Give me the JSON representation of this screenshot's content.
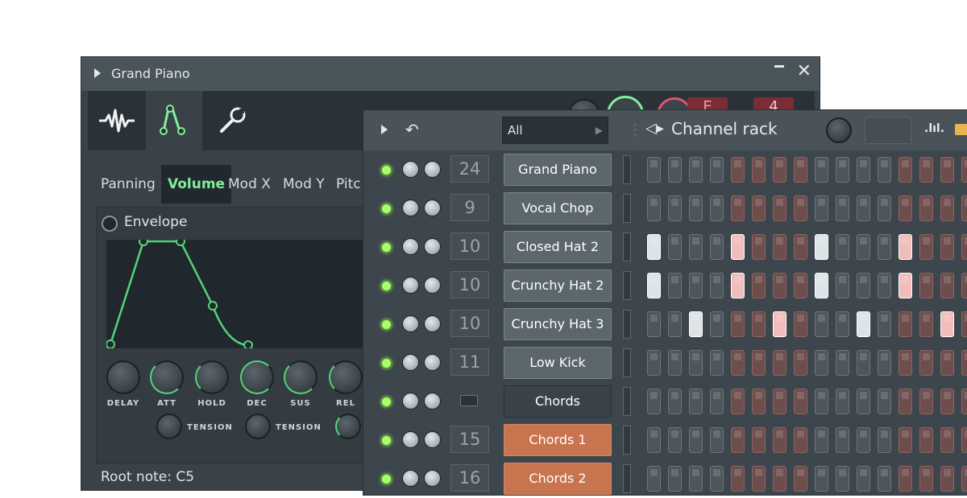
{
  "plugin": {
    "title": "Grand Piano",
    "tabs": [
      {
        "name": "waveform-icon"
      },
      {
        "name": "envelope-icon"
      },
      {
        "name": "wrench-icon"
      }
    ],
    "subtabs": [
      "Panning",
      "Volume",
      "Mod X",
      "Mod Y",
      "Pitc"
    ],
    "active_subtab": "Volume",
    "envelope": {
      "label": "Envelope",
      "knob_labels": [
        "DELAY",
        "ATT",
        "HOLD",
        "DEC",
        "SUS",
        "REL"
      ],
      "tension_labels": [
        "TENSION",
        "TENSION"
      ]
    },
    "root_note": "Root note: C5",
    "header_display_1": "E",
    "header_display_2": "4"
  },
  "rack": {
    "title": "Channel rack",
    "filter": "All",
    "rows": [
      {
        "num": "24",
        "name": "Grand Piano",
        "style": "normal"
      },
      {
        "num": "9",
        "name": "Vocal Chop",
        "style": "normal"
      },
      {
        "num": "10",
        "name": "Closed Hat 2",
        "style": "normal"
      },
      {
        "num": "10",
        "name": "Crunchy Hat 2",
        "style": "normal"
      },
      {
        "num": "10",
        "name": "Crunchy Hat 3",
        "style": "normal"
      },
      {
        "num": "11",
        "name": "Low Kick",
        "style": "normal"
      },
      {
        "num": "",
        "name": "Chords",
        "style": "dark"
      },
      {
        "num": "15",
        "name": "Chords 1",
        "style": "orange"
      },
      {
        "num": "16",
        "name": "Chords 2",
        "style": "orange"
      }
    ],
    "steps": [
      "ggggrrrrggggrrrr",
      "ggggrrrrggggrrrr",
      "wgggprrrwgggprrr",
      "wgggprrrwgggprrr",
      "ggwgrrprggwgrrpr",
      "ggggrrrrggggrrrr",
      "ggggrrrrggggrrrr",
      "ggggrrrrggggrrrr",
      "ggggrrrrggggrrrr"
    ]
  },
  "colors": {
    "accent_green": "#7ff09a",
    "led_green": "#a9ff6b",
    "orange": "#c7744f"
  }
}
